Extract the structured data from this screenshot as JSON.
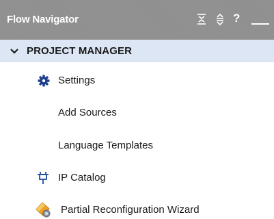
{
  "titlebar": {
    "title": "Flow Navigator",
    "icons": [
      "collapse-all-icon",
      "expand-all-icon",
      "help-icon",
      "minimize-icon"
    ],
    "help_glyph": "?"
  },
  "section": {
    "label": "PROJECT MANAGER",
    "icon": "chevron-down-icon",
    "background": "#dce6f5"
  },
  "items": [
    {
      "label": "Settings",
      "icon": "gear-icon",
      "icon_color": "#1e3f8c"
    },
    {
      "label": "Add Sources",
      "icon": null
    },
    {
      "label": "Language Templates",
      "icon": null
    },
    {
      "label": "IP Catalog",
      "icon": "ip-plug-icon",
      "icon_color": "#1e4fa0"
    },
    {
      "label": "Partial Reconfiguration Wizard",
      "icon": "wizard-icon",
      "icon_color": "#f0a020"
    }
  ]
}
